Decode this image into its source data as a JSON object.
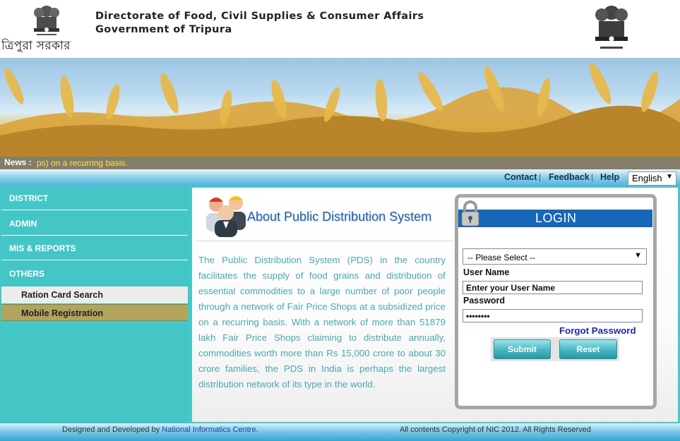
{
  "header": {
    "state_name": "ত্রিপুরা সরকার",
    "dept_title": "Directorate of Food, Civil Supplies & Consumer Affairs",
    "dept_subtitle": "Government of Tripura",
    "emblem_icon": "national-emblem-icon"
  },
  "news": {
    "label": "News :",
    "text": "ps) on a recurring basis.",
    "text_color": "#ffe14a"
  },
  "topnav": {
    "contact": "Contact",
    "feedback": "Feedback",
    "help": "Help",
    "separator": "|",
    "language": "English"
  },
  "sidebar": {
    "items": [
      {
        "label": "DISTRICT"
      },
      {
        "label": "ADMIN"
      },
      {
        "label": "MIS & REPORTS"
      },
      {
        "label": "OTHERS"
      }
    ],
    "subitems": [
      {
        "label": "Ration Card Search"
      },
      {
        "label": "Mobile Registration"
      }
    ]
  },
  "about": {
    "title": "About Public Distribution System",
    "body": "The Public Distribution System (PDS) in the country facilitates the supply of food grains and distribution of essential commodities to a large number of poor people through a network of Fair Price Shops at a subsidized price on a recurring basis. With a network of more than 51879 lakh Fair Price Shops claiming to distribute annually, commodities worth more than Rs 15,000 crore to about 30 crore families, the PDS in India is perhaps the largest distribution network of its type in the world."
  },
  "login": {
    "title": "LOGIN",
    "role_select": "-- Please Select --",
    "username_label": "User Name",
    "username_value": "Enter your User Name",
    "password_label": "Password",
    "password_value": "••••••••",
    "forgot": "Forgot Password",
    "submit": "Submit",
    "reset": "Reset"
  },
  "footer": {
    "designed_prefix": "Designed and Developed by",
    "designed_link": "National Informatics Centre.",
    "copyright": "All contents Copyright of NIC 2012. All Rights Reserved"
  },
  "colors": {
    "sidebar": "#44c6c6",
    "login_bar": "#1767b9",
    "about_title": "#2463a6",
    "about_text": "#4aa7b2",
    "newsbar": "#857d6a"
  }
}
